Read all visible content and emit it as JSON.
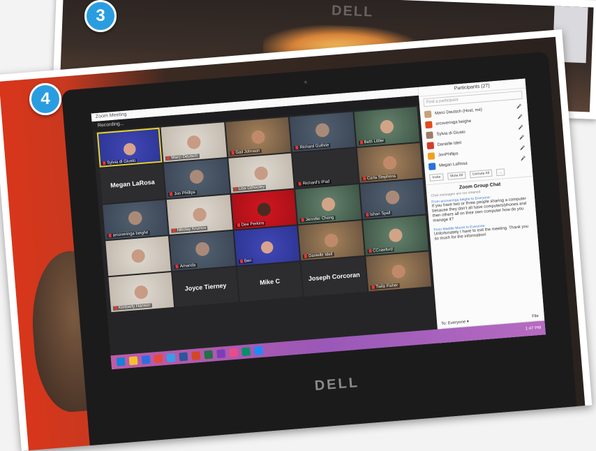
{
  "badges": {
    "back": "3",
    "front": "4"
  },
  "brand": {
    "back_logo": "DELL",
    "laptop_logo": "DELL"
  },
  "zoom": {
    "window_title": "Zoom Meeting",
    "recording_label": "Recording...",
    "participants_title": "Participants (27)",
    "search_placeholder": "Find a participant",
    "participants": [
      {
        "name": "Marci Deutsch (Host, me)",
        "color": "#c9a07a"
      },
      {
        "name": "arcoveringa beighe",
        "color": "#e04a1e"
      },
      {
        "name": "Sylvia di Giusto",
        "color": "#9c7c6a"
      },
      {
        "name": "Danielle Ideil",
        "color": "#d63a2a"
      },
      {
        "name": "JonPhillips",
        "color": "#f0a020"
      },
      {
        "name": "Megan LaRosa",
        "color": "#2a72d8"
      }
    ],
    "buttons": {
      "invite": "Invite",
      "mute_all": "Mute All",
      "unmute_all": "Unmute All",
      "more": "..."
    },
    "chat": {
      "title": "Zoom Group Chat",
      "note": "Chat messages are not retained",
      "messages": [
        {
          "from": "From arcoveringa beighe to Everyone:",
          "text": "If you have two or three people sharing a computer because they don't all have computers/phones and then others all on their own computer how do you manage it?"
        },
        {
          "from": "From Maddie Moore to Everyone:",
          "text": "Unfortunately I have to exit the meeting. Thank you so much for the information!"
        }
      ],
      "to_label": "To: Everyone ▾",
      "file_label": "File",
      "input_placeholder": "Type message here..."
    },
    "tiles": [
      {
        "name": "Sylvia di Giusto",
        "style": "cam blue active",
        "big": ""
      },
      {
        "name": "Marci Deutsch",
        "style": "cam light",
        "big": ""
      },
      {
        "name": "Gail Johnson",
        "style": "cam warm",
        "big": ""
      },
      {
        "name": "Richard Guthrie",
        "style": "cam",
        "big": ""
      },
      {
        "name": "Beth Littler",
        "style": "cam green",
        "big": ""
      },
      {
        "name": "",
        "style": "",
        "big": "Megan LaRosa"
      },
      {
        "name": "Jon Phillips",
        "style": "cam",
        "big": ""
      },
      {
        "name": "Lisa Gilhooley",
        "style": "cam light",
        "big": ""
      },
      {
        "name": "Richard's iPad",
        "style": "",
        "big": ""
      },
      {
        "name": "Carla Stephens",
        "style": "cam warm",
        "big": ""
      },
      {
        "name": "arcoveringa beighe",
        "style": "cam",
        "big": ""
      },
      {
        "name": "Nikolay Krumov",
        "style": "cam light",
        "big": ""
      },
      {
        "name": "Dee Perkins",
        "style": "cam red",
        "big": ""
      },
      {
        "name": "Jennifer Cheng",
        "style": "cam green",
        "big": ""
      },
      {
        "name": "Ishan Spell",
        "style": "cam",
        "big": ""
      },
      {
        "name": "",
        "style": "cam light",
        "big": ""
      },
      {
        "name": "Amanda",
        "style": "cam",
        "big": ""
      },
      {
        "name": "Ben",
        "style": "cam blue",
        "big": ""
      },
      {
        "name": "Danielle Ideil",
        "style": "cam warm",
        "big": ""
      },
      {
        "name": "CCrawford",
        "style": "cam green",
        "big": ""
      },
      {
        "name": "Kimberly Hanson",
        "style": "cam light",
        "big": ""
      },
      {
        "name": "",
        "style": "",
        "big": "Joyce Tierney"
      },
      {
        "name": "",
        "style": "",
        "big": "Mike C"
      },
      {
        "name": "",
        "style": "",
        "big": "Joseph Corcoran"
      },
      {
        "name": "Twila Fisher",
        "style": "cam warm",
        "big": ""
      }
    ],
    "taskbar": {
      "time": "1:47 PM",
      "icons": [
        "#1a7fd8",
        "#f2c130",
        "#2f6ee0",
        "#e84a3a",
        "#3a9de8",
        "#2b579a",
        "#d24726",
        "#217346",
        "#7a3fb5",
        "#ea4c89",
        "#0a8f6a",
        "#1d8cf8"
      ]
    }
  }
}
